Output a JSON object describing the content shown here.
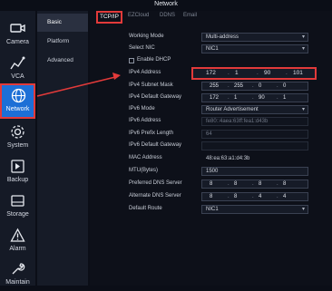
{
  "window": {
    "title": "Network"
  },
  "sidebar": {
    "items": [
      {
        "label": "Camera",
        "icon": "camera-icon"
      },
      {
        "label": "VCA",
        "icon": "vca-icon"
      },
      {
        "label": "Network",
        "icon": "globe-icon",
        "active": true
      },
      {
        "label": "System",
        "icon": "gear-icon"
      },
      {
        "label": "Backup",
        "icon": "backup-icon"
      },
      {
        "label": "Storage",
        "icon": "storage-icon"
      },
      {
        "label": "Alarm",
        "icon": "alarm-icon"
      },
      {
        "label": "Maintain",
        "icon": "wrench-icon"
      }
    ]
  },
  "subnav": {
    "items": [
      "Basic",
      "Platform",
      "Advanced"
    ]
  },
  "tabs": [
    "TCP/IP",
    "EZCloud",
    "DDNS",
    "Email"
  ],
  "form": {
    "working_mode": {
      "label": "Working Mode",
      "value": "Multi-address"
    },
    "select_nic": {
      "label": "Select NIC",
      "value": "NIC1"
    },
    "enable_dhcp": {
      "label": "Enable DHCP",
      "checked": false
    },
    "ipv4_address": {
      "label": "IPv4 Address",
      "octets": [
        "172",
        "1",
        "90",
        "101"
      ]
    },
    "ipv4_mask": {
      "label": "IPv4 Subnet Mask",
      "octets": [
        "255",
        "255",
        "0",
        "0"
      ]
    },
    "ipv4_gateway": {
      "label": "IPv4 Default Gateway",
      "octets": [
        "172",
        "1",
        "90",
        "1"
      ]
    },
    "ipv6_mode": {
      "label": "IPv6 Mode",
      "value": "Router Advertisement"
    },
    "ipv6_address": {
      "label": "IPv6 Address",
      "value": "fe80::4aea:63ff:fea1:d43b"
    },
    "ipv6_prefix": {
      "label": "IPv6 Prefix Length",
      "value": "64"
    },
    "ipv6_gateway": {
      "label": "IPv6 Default Gateway",
      "value": ""
    },
    "mac": {
      "label": "MAC Address",
      "value": "48:ea:63:a1:d4:3b"
    },
    "mtu": {
      "label": "MTU(Bytes)",
      "value": "1500"
    },
    "pref_dns": {
      "label": "Preferred DNS Server",
      "octets": [
        "8",
        "8",
        "8",
        "8"
      ]
    },
    "alt_dns": {
      "label": "Alternate DNS Server",
      "octets": [
        "8",
        "8",
        "4",
        "4"
      ]
    },
    "default_route": {
      "label": "Default Route",
      "value": "NIC1"
    }
  },
  "colors": {
    "highlight": "#e23a3a",
    "active_nav": "#1d6fd6"
  }
}
